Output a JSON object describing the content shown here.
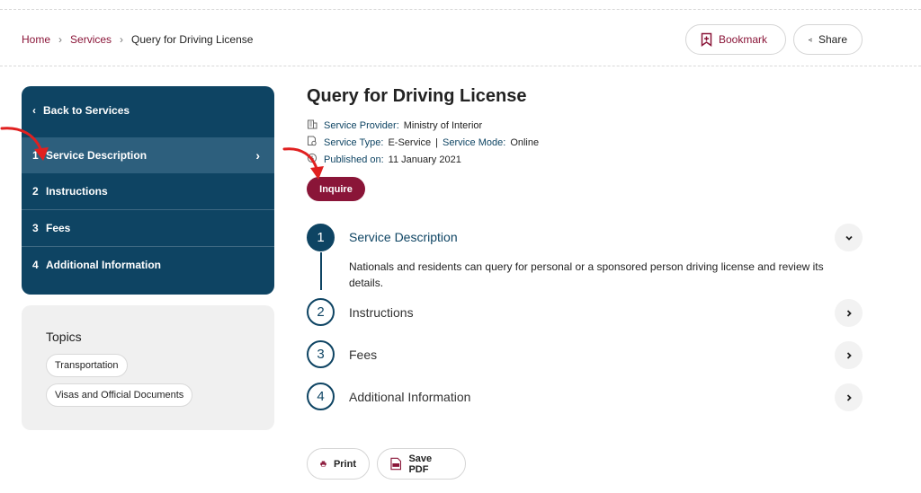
{
  "breadcrumb": {
    "home": "Home",
    "services": "Services",
    "current": "Query for Driving License"
  },
  "header": {
    "bookmark_label": "Bookmark",
    "share_label": "Share"
  },
  "sidebar": {
    "back_label": "Back to Services",
    "items": [
      {
        "num": "1",
        "label": "Service Description",
        "active": true
      },
      {
        "num": "2",
        "label": "Instructions"
      },
      {
        "num": "3",
        "label": "Fees"
      },
      {
        "num": "4",
        "label": "Additional Information"
      }
    ]
  },
  "topics": {
    "title": "Topics",
    "tags": [
      "Transportation",
      "Visas and Official Documents"
    ]
  },
  "service": {
    "title": "Query for Driving License",
    "provider_label": "Service Provider:",
    "provider_value": "Ministry of Interior",
    "type_label": "Service Type:",
    "type_value": "E-Service",
    "separator": "|",
    "mode_label": "Service Mode:",
    "mode_value": "Online",
    "published_label": "Published on:",
    "published_value": "11 January 2021",
    "inquire_label": "Inquire"
  },
  "steps": [
    {
      "num": "1",
      "title": "Service Description",
      "expanded": true,
      "body": "Nationals and residents can query for personal or a sponsored person driving license and review its details."
    },
    {
      "num": "2",
      "title": "Instructions"
    },
    {
      "num": "3",
      "title": "Fees"
    },
    {
      "num": "4",
      "title": "Additional Information"
    }
  ],
  "actions": {
    "print_label": "Print",
    "save_pdf_label": "Save PDF"
  },
  "colors": {
    "brand_maroon": "#8a1538",
    "nav_blue": "#0e4463",
    "annotation_red": "#e02020"
  }
}
